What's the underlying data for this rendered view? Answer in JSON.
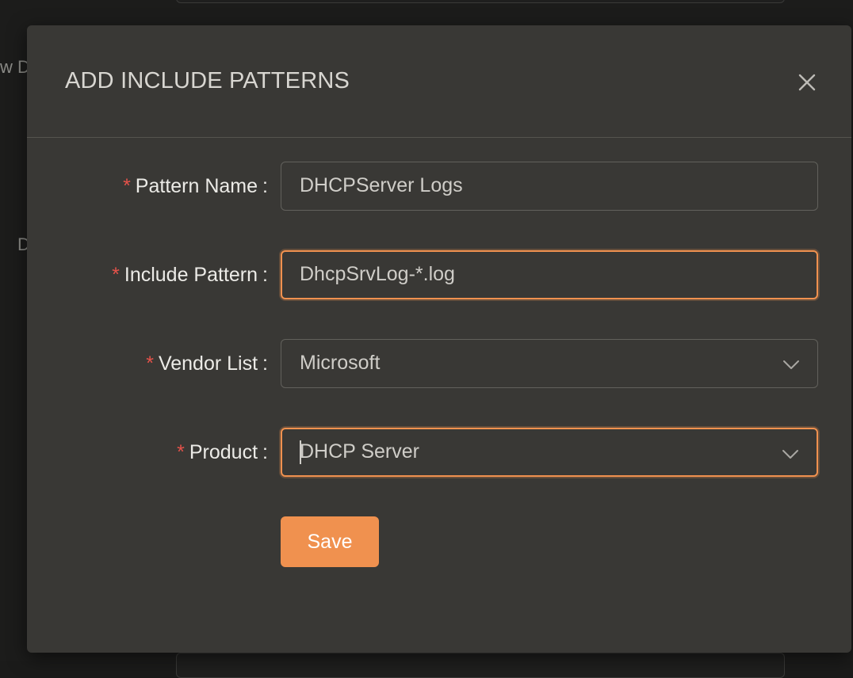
{
  "background": {
    "partial_text_1": "w D",
    "partial_text_2": "D"
  },
  "modal": {
    "title": "ADD INCLUDE PATTERNS",
    "close_icon": "close-icon"
  },
  "form": {
    "pattern_name": {
      "label": "Pattern Name",
      "required_mark": "*",
      "value": "DHCPServer Logs"
    },
    "include_pattern": {
      "label": "Include Pattern",
      "required_mark": "*",
      "value": "DhcpSrvLog-*.log"
    },
    "vendor_list": {
      "label": "Vendor List",
      "required_mark": "*",
      "selected": "Microsoft",
      "icon": "chevron-down-icon"
    },
    "product": {
      "label": "Product",
      "required_mark": "*",
      "selected": "DHCP Server",
      "icon": "chevron-down-icon"
    },
    "colon": ":",
    "save_label": "Save"
  },
  "colors": {
    "accent": "#f0914f",
    "required": "#e5524a",
    "modal_bg": "#393835",
    "page_bg": "#1c1c1b"
  }
}
